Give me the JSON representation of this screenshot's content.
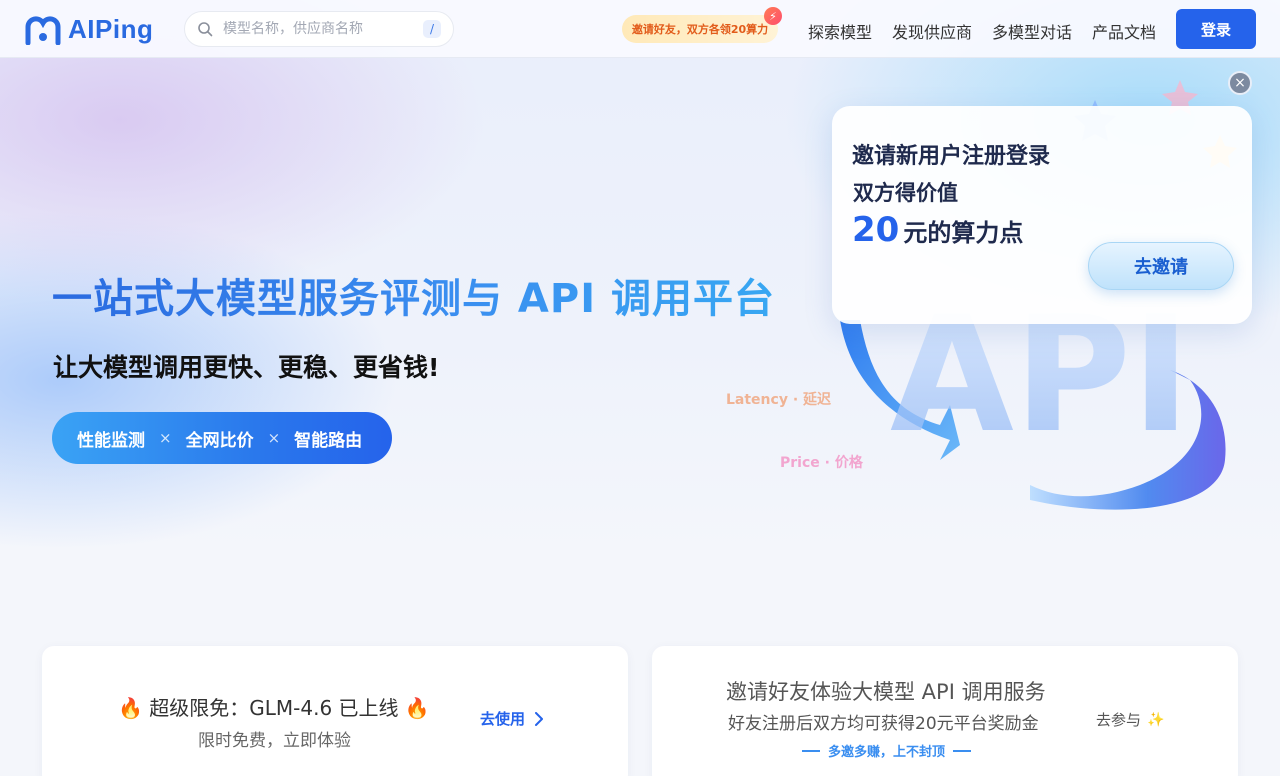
{
  "header": {
    "logo_text": "AIPing",
    "search_placeholder": "模型名称，供应商名称",
    "search_shortcut": "/",
    "promo": "邀请好友，双方各领20算力",
    "nav": [
      "探索模型",
      "发现供应商",
      "多模型对话",
      "产品文档"
    ],
    "login_label": "登录"
  },
  "hero": {
    "title": "一站式大模型服务评测与 API 调用平台",
    "subtitle": "让大模型调用更快、更稳、更省钱!",
    "features": [
      "性能监测",
      "全网比价",
      "智能路由"
    ],
    "feature_separator": "×",
    "metric_latency": "Latency · 延迟",
    "metric_price": "Price · 价格",
    "graphic_text": "API"
  },
  "invite_popup": {
    "line1": "邀请新用户注册登录",
    "line2": "双方得价值",
    "amount": "20",
    "amount_unit": "元的算力点",
    "button_label": "去邀请",
    "close_symbol": "×"
  },
  "cards": {
    "free": {
      "title": "🔥 超级限免：GLM-4.6 已上线 🔥",
      "subtitle": "限时免费，立即体验",
      "link_label": "去使用"
    },
    "referral": {
      "title": "邀请好友体验大模型 API 调用服务",
      "subtitle": "好友注册后双方均可获得20元平台奖励金",
      "slogan": "多邀多赚，上不封顶",
      "link_label": "去参与"
    }
  },
  "colors": {
    "brand": "#2563eb",
    "accent_light": "#3a8ef0",
    "promo_text": "#e25c1b"
  }
}
